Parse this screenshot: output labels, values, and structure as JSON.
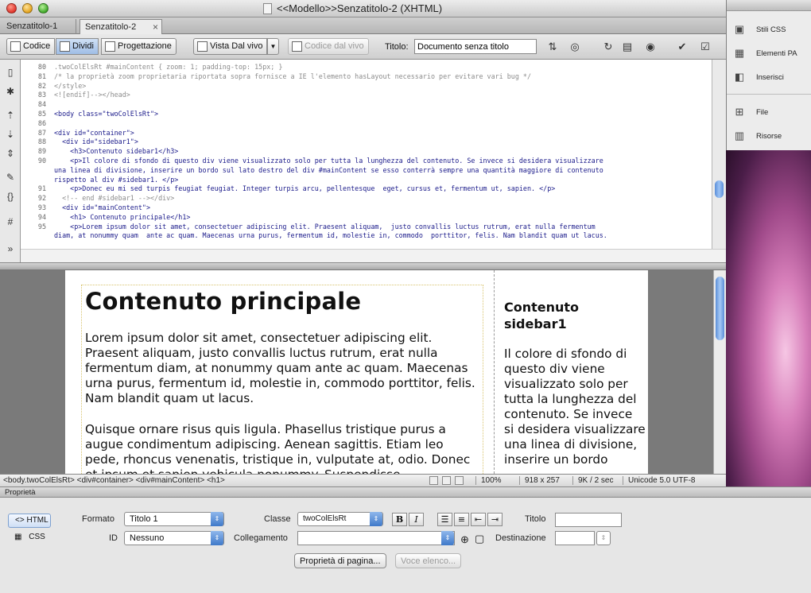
{
  "window": {
    "title": "<<Modello>>Senzatitolo-2 (XHTML)"
  },
  "tabs": [
    {
      "label": "Senzatitolo-1"
    },
    {
      "label": "Senzatitolo-2"
    }
  ],
  "toolbar": {
    "code_label": "Codice",
    "split_label": "Dividi",
    "design_label": "Progettazione",
    "live_view_label": "Vista Dal vivo",
    "live_code_label": "Codice dal vivo",
    "title_label": "Titolo:",
    "title_value": "Documento senza titolo"
  },
  "code": {
    "line_numbers": [
      "80",
      "81",
      "82",
      "83",
      "84",
      "85",
      "86",
      "87",
      "88",
      "89",
      "90",
      "",
      "",
      "91",
      "92",
      "93",
      "94",
      "95",
      ""
    ],
    "lines": [
      ".twoColElsRt #mainContent { zoom: 1; padding-top: 15px; }",
      "/* la proprietà zoom proprietaria riportata sopra fornisce a IE l'elemento hasLayout necessario per evitare vari bug */",
      "</style>",
      "<![endif]--></head>",
      "",
      "<body class=\"twoColElsRt\">",
      "",
      "<div id=\"container\">",
      "  <div id=\"sidebar1\">",
      "    <h3>Contenuto sidebar1</h3>",
      "    <p>Il colore di sfondo di questo div viene visualizzato solo per tutta la lunghezza del contenuto. Se invece si desidera visualizzare",
      "una linea di divisione, inserire un bordo sul lato destro del div #mainContent se esso conterrà sempre una quantità maggiore di contenuto",
      "rispetto al div #sidebar1. </p>",
      "    <p>Donec eu mi sed turpis feugiat feugiat. Integer turpis arcu, pellentesque  eget, cursus et, fermentum ut, sapien. </p>",
      "  <!-- end #sidebar1 --></div>",
      "  <div id=\"mainContent\">",
      "    <h1> Contenuto principale</h1>",
      "    <p>Lorem ipsum dolor sit amet, consectetuer adipiscing elit. Praesent aliquam,  justo convallis luctus rutrum, erat nulla fermentum",
      "diam, at nonummy quam  ante ac quam. Maecenas urna purus, fermentum id, molestie in, commodo  porttitor, felis. Nam blandit quam ut lacus."
    ]
  },
  "design": {
    "main_heading": "Contenuto principale",
    "main_para1": "Lorem ipsum dolor sit amet, consectetuer adipiscing elit. Praesent aliquam, justo convallis luctus rutrum, erat nulla fermentum diam, at nonummy quam ante ac quam. Maecenas urna purus, fermentum id, molestie in, commodo porttitor, felis. Nam blandit quam ut lacus.",
    "main_para2": "Quisque ornare risus quis ligula. Phasellus tristique purus a augue condimentum adipiscing. Aenean sagittis. Etiam leo pede, rhoncus venenatis, tristique in, vulputate at, odio. Donec et ipsum et sapien vehicula nonummy. Suspendisse",
    "sidebar_heading": "Contenuto sidebar1",
    "sidebar_text": "Il colore di sfondo di questo div viene visualizzato solo per tutta la lunghezza del contenuto. Se invece si desidera visualizzare una linea di divisione, inserire un bordo"
  },
  "status": {
    "tag_selector": "<body.twoColElsRt> <div#container> <div#mainContent> <h1>",
    "zoom": "100%",
    "window_size": "918 x 257",
    "file_size": "9K / 2 sec",
    "encoding": "Unicode 5.0 UTF-8"
  },
  "properties": {
    "panel_title": "Proprietà",
    "html_label": "HTML",
    "css_label": "CSS",
    "format_label": "Formato",
    "format_value": "Titolo 1",
    "class_label": "Classe",
    "class_value": "twoColElsRt",
    "bold_label": "B",
    "italic_label": "I",
    "title_label": "Titolo",
    "id_label": "ID",
    "id_value": "Nessuno",
    "link_label": "Collegamento",
    "target_label": "Destinazione",
    "page_props_button": "Proprietà di pagina...",
    "list_item_button": "Voce elenco..."
  },
  "right_panel": {
    "items": [
      {
        "label": "Stili CSS",
        "icon": "css-styles-icon"
      },
      {
        "label": "Elementi PA",
        "icon": "ap-elements-icon"
      },
      {
        "label": "Inserisci",
        "icon": "insert-icon"
      },
      {
        "label": "File",
        "icon": "files-icon"
      },
      {
        "label": "Risorse",
        "icon": "assets-icon"
      }
    ]
  },
  "colors": {
    "accent_blue": "#4a84d6",
    "desktop_pink": "#d77fba"
  }
}
